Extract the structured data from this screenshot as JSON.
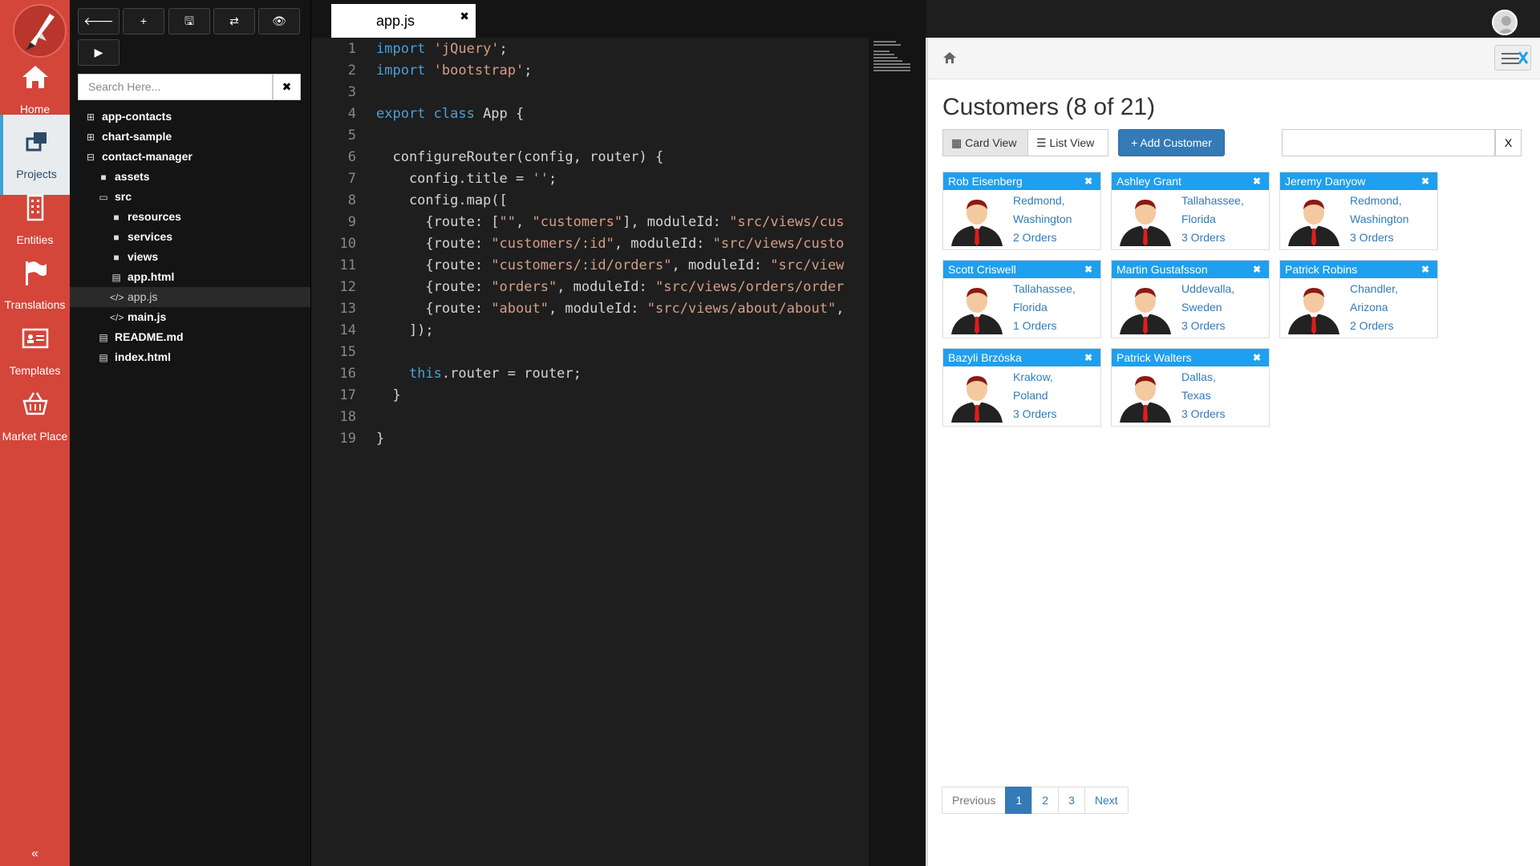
{
  "nav": {
    "items": [
      {
        "label": "Home",
        "icon": "home-icon"
      },
      {
        "label": "Projects",
        "icon": "projects-icon"
      },
      {
        "label": "Entities",
        "icon": "building-icon"
      },
      {
        "label": "Translations",
        "icon": "flag-icon"
      },
      {
        "label": "Templates",
        "icon": "id-card-icon"
      },
      {
        "label": "Market Place",
        "icon": "basket-icon"
      }
    ],
    "active": "Projects",
    "collapse_glyph": "«"
  },
  "toolbar": {
    "buttons": [
      {
        "icon": "arrow-left-icon",
        "glyph": "🡐"
      },
      {
        "icon": "plus-icon",
        "glyph": "+"
      },
      {
        "icon": "save-icon",
        "glyph": "🖫"
      },
      {
        "icon": "refresh-icon",
        "glyph": "⇄"
      },
      {
        "icon": "eye-icon",
        "glyph": "👁"
      },
      {
        "icon": "play-icon",
        "glyph": "▶"
      }
    ],
    "search_placeholder": "Search Here...",
    "search_clear": "✖"
  },
  "tree": [
    {
      "label": "app-contacts",
      "icon": "plus-square-icon",
      "glyph": "⊞",
      "depth": 0
    },
    {
      "label": "chart-sample",
      "icon": "plus-square-icon",
      "glyph": "⊞",
      "depth": 0
    },
    {
      "label": "contact-manager",
      "icon": "minus-square-icon",
      "glyph": "⊟",
      "depth": 0
    },
    {
      "label": "assets",
      "icon": "folder-icon",
      "glyph": "■",
      "depth": 1
    },
    {
      "label": "src",
      "icon": "folder-open-icon",
      "glyph": "▭",
      "depth": 1
    },
    {
      "label": "resources",
      "icon": "folder-icon",
      "glyph": "■",
      "depth": 2
    },
    {
      "label": "services",
      "icon": "folder-icon",
      "glyph": "■",
      "depth": 2
    },
    {
      "label": "views",
      "icon": "folder-icon",
      "glyph": "■",
      "depth": 2
    },
    {
      "label": "app.html",
      "icon": "file-icon",
      "glyph": "▤",
      "depth": 2
    },
    {
      "label": "app.js",
      "icon": "code-icon",
      "glyph": "</>",
      "depth": 2,
      "selected": true
    },
    {
      "label": "main.js",
      "icon": "code-icon",
      "glyph": "</>",
      "depth": 2
    },
    {
      "label": "README.md",
      "icon": "file-icon",
      "glyph": "▤",
      "depth": 1
    },
    {
      "label": "index.html",
      "icon": "file-icon",
      "glyph": "▤",
      "depth": 1
    }
  ],
  "editor": {
    "tab_title": "app.js",
    "tab_close": "✖",
    "lines": [
      [
        {
          "t": "import ",
          "c": "kw"
        },
        {
          "t": "'jQuery'",
          "c": "str"
        },
        {
          "t": ";",
          "c": ""
        }
      ],
      [
        {
          "t": "import ",
          "c": "kw"
        },
        {
          "t": "'bootstrap'",
          "c": "str"
        },
        {
          "t": ";",
          "c": ""
        }
      ],
      [],
      [
        {
          "t": "export class ",
          "c": "kw"
        },
        {
          "t": "App {",
          "c": ""
        }
      ],
      [],
      [
        {
          "t": "  configureRouter(config, router) {",
          "c": ""
        }
      ],
      [
        {
          "t": "    config.title = ",
          "c": ""
        },
        {
          "t": "''",
          "c": "str"
        },
        {
          "t": ";",
          "c": ""
        }
      ],
      [
        {
          "t": "    config.map([",
          "c": ""
        }
      ],
      [
        {
          "t": "      {route: [",
          "c": ""
        },
        {
          "t": "\"\"",
          "c": "str"
        },
        {
          "t": ", ",
          "c": ""
        },
        {
          "t": "\"customers\"",
          "c": "str"
        },
        {
          "t": "], moduleId: ",
          "c": ""
        },
        {
          "t": "\"src/views/cus",
          "c": "str"
        }
      ],
      [
        {
          "t": "      {route: ",
          "c": ""
        },
        {
          "t": "\"customers/:id\"",
          "c": "str"
        },
        {
          "t": ", moduleId: ",
          "c": ""
        },
        {
          "t": "\"src/views/custo",
          "c": "str"
        }
      ],
      [
        {
          "t": "      {route: ",
          "c": ""
        },
        {
          "t": "\"customers/:id/orders\"",
          "c": "str"
        },
        {
          "t": ", moduleId: ",
          "c": ""
        },
        {
          "t": "\"src/view",
          "c": "str"
        }
      ],
      [
        {
          "t": "      {route: ",
          "c": ""
        },
        {
          "t": "\"orders\"",
          "c": "str"
        },
        {
          "t": ", moduleId: ",
          "c": ""
        },
        {
          "t": "\"src/views/orders/order",
          "c": "str"
        }
      ],
      [
        {
          "t": "      {route: ",
          "c": ""
        },
        {
          "t": "\"about\"",
          "c": "str"
        },
        {
          "t": ", moduleId: ",
          "c": ""
        },
        {
          "t": "\"src/views/about/about\"",
          "c": "str"
        },
        {
          "t": ",",
          "c": ""
        }
      ],
      [
        {
          "t": "    ]);",
          "c": ""
        }
      ],
      [],
      [
        {
          "t": "    this",
          "c": "kw"
        },
        {
          "t": ".router = router;",
          "c": ""
        }
      ],
      [
        {
          "t": "  }",
          "c": ""
        }
      ],
      [],
      [
        {
          "t": "}",
          "c": ""
        }
      ]
    ]
  },
  "browser": {
    "title": "Customers (8 of 21)",
    "card_view_label": "Card View",
    "list_view_label": "List View",
    "add_label": "+ Add Customer",
    "filter_clear": "X",
    "remove_glyph": "✖",
    "customers": [
      {
        "name": "Rob Eisenberg",
        "city": "Redmond,",
        "region": "Washington",
        "orders": "2 Orders"
      },
      {
        "name": "Ashley Grant",
        "city": "Tallahassee,",
        "region": "Florida",
        "orders": "3 Orders"
      },
      {
        "name": "Jeremy Danyow",
        "city": "Redmond,",
        "region": "Washington",
        "orders": "3 Orders"
      },
      {
        "name": "Scott Criswell",
        "city": "Tallahassee,",
        "region": "Florida",
        "orders": "1 Orders"
      },
      {
        "name": "Martin Gustafsson",
        "city": "Uddevalla,",
        "region": "Sweden",
        "orders": "3 Orders"
      },
      {
        "name": "Patrick Robins",
        "city": "Chandler,",
        "region": "Arizona",
        "orders": "2 Orders"
      },
      {
        "name": "Bazyli Brzóska",
        "city": "Krakow,",
        "region": "Poland",
        "orders": "3 Orders"
      },
      {
        "name": "Patrick Walters",
        "city": "Dallas,",
        "region": "Texas",
        "orders": "3 Orders"
      }
    ],
    "pagination": {
      "previous": "Previous",
      "pages": [
        "1",
        "2",
        "3"
      ],
      "active": "1",
      "next": "Next"
    }
  },
  "colors": {
    "nav_red": "#d4453a",
    "accent_blue": "#1e9fef",
    "btn_blue": "#337ab7"
  }
}
